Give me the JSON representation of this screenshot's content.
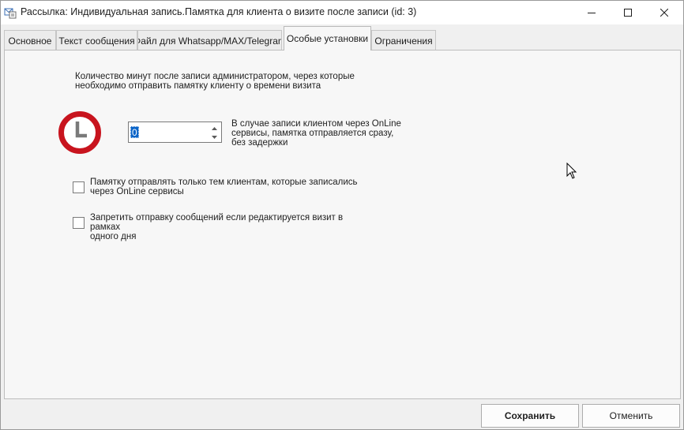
{
  "window": {
    "title": "Рассылка: Индивидуальная запись.Памятка для клиента о визите после записи (id: 3)",
    "icon": "mail-document-icon",
    "controls": [
      "minimize-icon",
      "maximize-icon",
      "close-icon"
    ]
  },
  "tabs": [
    {
      "label": "Основное",
      "active": false
    },
    {
      "label": "Текст сообщения",
      "active": false
    },
    {
      "label": "Файл для Whatsapp/MAX/Telegram",
      "active": false
    },
    {
      "label": "Особые установки",
      "active": true
    },
    {
      "label": "Ограничения",
      "active": false
    }
  ],
  "settings": {
    "minutes_description": "Количество минут после записи администратором, через которые\nнеобходимо отправить памятку клиенту о времени визита",
    "minutes_value": "0",
    "online_note": "В случае записи клиентом через OnLine\nсервисы, памятка отправляется сразу,\nбез задержки",
    "clock_icon": "clock-icon",
    "colors": {
      "clock_ring": "#c8141e",
      "selection": "#0a64c8"
    }
  },
  "checkboxes": [
    {
      "label": "Памятку отправлять только тем клиентам, которые записались\nчерез OnLine сервисы",
      "checked": false
    },
    {
      "label": "Запретить отправку сообщений если редактируется визит в рамках\nодного дня",
      "checked": false
    }
  ],
  "footer": {
    "save_label": "Сохранить",
    "cancel_label": "Отменить"
  }
}
